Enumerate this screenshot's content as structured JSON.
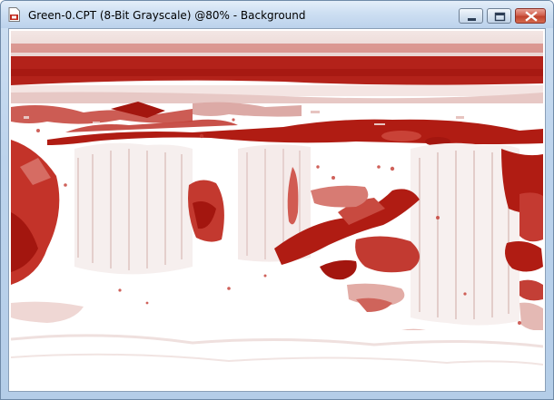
{
  "window": {
    "title": "Green-0.CPT (8-Bit Grayscale) @80% - Background"
  },
  "controls": {
    "minimize_icon": "minimize-icon",
    "maximize_icon": "maximize-icon",
    "close_icon": "close-icon"
  },
  "canvas": {
    "description_colors": {
      "ink": "#b01c13",
      "paper": "#ffffff"
    }
  }
}
